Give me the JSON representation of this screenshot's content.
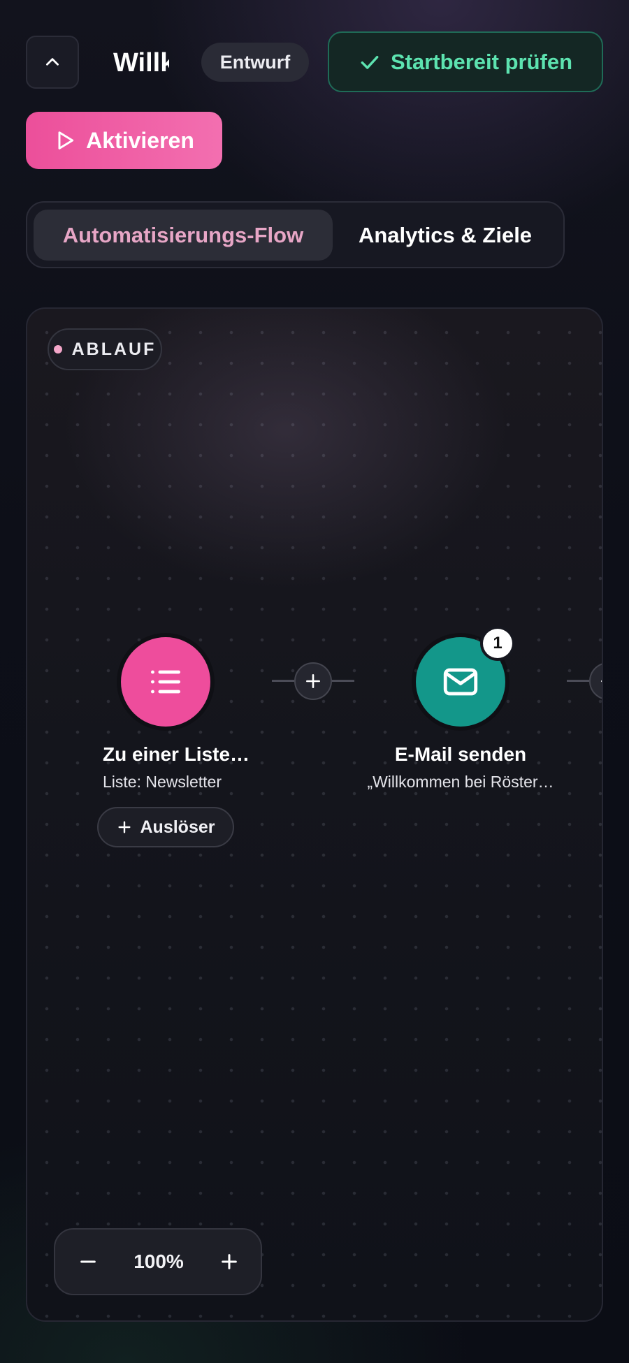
{
  "header": {
    "title": "Willkommens-Serie",
    "status_badge": "Entwurf",
    "check_label": "Startbereit prüfen",
    "activate_label": "Aktivieren"
  },
  "tabs": [
    {
      "label": "Automatisierungs-Flow",
      "active": true
    },
    {
      "label": "Analytics & Ziele",
      "active": false
    }
  ],
  "canvas": {
    "section_label": "ABLAUF",
    "nodes": [
      {
        "title": "Zu einer Liste…",
        "subtitle": "Liste: Newsletter",
        "icon": "list-icon",
        "color": "#ee4d9c",
        "action_label": "Auslöser"
      },
      {
        "title": "E-Mail senden",
        "subtitle": "„Willkommen bei Röster…",
        "icon": "mail-icon",
        "color": "#13978a",
        "badge": "1"
      }
    ],
    "zoom": "100%"
  },
  "colors": {
    "accent_pink": "#ee4d9c",
    "accent_teal": "#13978a",
    "ready_green": "#5de3b0"
  }
}
